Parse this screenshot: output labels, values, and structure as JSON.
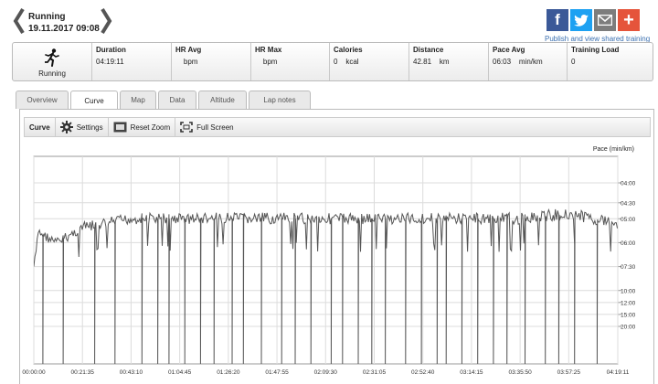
{
  "header": {
    "activity": "Running",
    "datetime": "19.11.2017 09:08",
    "prev_icon": "chevron-left-icon",
    "next_icon": "chevron-right-icon"
  },
  "share": {
    "buttons": [
      {
        "name": "facebook",
        "icon": "facebook-icon",
        "glyph": "f",
        "color": "#3b5998"
      },
      {
        "name": "twitter",
        "icon": "twitter-icon",
        "glyph": "t",
        "color": "#1da1f2"
      },
      {
        "name": "email",
        "icon": "mail-icon",
        "glyph": "✉",
        "color": "#7d7d7d"
      },
      {
        "name": "more",
        "icon": "plus-icon",
        "glyph": "+",
        "color": "#e5543b"
      }
    ],
    "link_text": "Publish and view shared training"
  },
  "summary": {
    "type_label": "Running",
    "type_icon": "runner-icon",
    "fields": [
      {
        "label": "Duration",
        "value": "04:19:11"
      },
      {
        "label": "HR Avg",
        "value": "    bpm"
      },
      {
        "label": "HR Max",
        "value": "    bpm"
      },
      {
        "label": "Calories",
        "value": "0    kcal"
      },
      {
        "label": "Distance",
        "value": "42.81    km"
      },
      {
        "label": "Pace Avg",
        "value": "06:03    min/km"
      },
      {
        "label": "Training Load",
        "value": "0"
      }
    ]
  },
  "tabs": [
    {
      "label": "Overview",
      "active": false
    },
    {
      "label": "Curve",
      "active": true
    },
    {
      "label": "Map",
      "active": false
    },
    {
      "label": "Data",
      "active": false
    },
    {
      "label": "Altitude",
      "active": false
    },
    {
      "label": "Lap notes",
      "active": false
    }
  ],
  "toolbar": {
    "curve_label": "Curve",
    "settings_label": "Settings",
    "settings_icon": "gear-icon",
    "reset_zoom_label": "Reset Zoom",
    "reset_zoom_icon": "zoom-reset-icon",
    "full_screen_label": "Full Screen",
    "full_screen_icon": "fullscreen-icon"
  },
  "chart_data": {
    "type": "line",
    "ylabel": "Pace (min/km)",
    "x_unit": "elapsed time (hh:mm:ss)",
    "x_range": [
      "00:00:00",
      "04:19:11"
    ],
    "x_ticks": [
      "00:00:00",
      "00:21:35",
      "00:43:10",
      "01:04:45",
      "01:26:20",
      "01:47:55",
      "02:09:30",
      "02:31:05",
      "02:52:40",
      "03:14:15",
      "03:35:50",
      "03:57:25",
      "04:19:11"
    ],
    "y_scale": "reciprocal (speed-linear), slower pace lower",
    "y_ticks": [
      "04:00",
      "04:30",
      "05:00",
      "06:00",
      "07:30",
      "10:00",
      "12:00",
      "15:00",
      "20:00"
    ],
    "grid": true,
    "series": [
      {
        "color": "#555555",
        "baseline_points": [
          {
            "x": "00:00:00",
            "pace": "07:30"
          },
          {
            "x": "00:02:00",
            "pace": "05:30"
          },
          {
            "x": "00:10:00",
            "pace": "06:00"
          },
          {
            "x": "00:21:35",
            "pace": "05:20"
          },
          {
            "x": "00:43:10",
            "pace": "05:00"
          },
          {
            "x": "01:04:45",
            "pace": "05:00"
          },
          {
            "x": "01:26:20",
            "pace": "05:00"
          },
          {
            "x": "01:47:55",
            "pace": "05:00"
          },
          {
            "x": "02:09:30",
            "pace": "05:00"
          },
          {
            "x": "02:31:05",
            "pace": "05:00"
          },
          {
            "x": "02:52:40",
            "pace": "05:00"
          },
          {
            "x": "03:14:15",
            "pace": "05:00"
          },
          {
            "x": "03:35:50",
            "pace": "05:00"
          },
          {
            "x": "03:57:25",
            "pace": "04:50"
          },
          {
            "x": "04:19:11",
            "pace": "05:10"
          }
        ],
        "pace_drops_to_off_scale_at": [
          "00:04:00",
          "00:13:00",
          "00:27:00",
          "00:36:00",
          "00:48:00",
          "00:55:00",
          "01:00:00",
          "01:07:00",
          "01:14:00",
          "01:20:00",
          "01:28:00",
          "01:33:00",
          "01:41:00",
          "01:50:00",
          "01:56:00",
          "02:03:00",
          "02:12:00",
          "02:17:00",
          "02:24:00",
          "02:30:00",
          "02:36:00",
          "02:45:00",
          "02:52:00",
          "02:59:00",
          "03:03:00",
          "03:10:00",
          "03:17:00",
          "03:24:00",
          "03:30:00",
          "03:38:00",
          "03:47:00",
          "03:53:00",
          "04:00:00",
          "04:10:00"
        ]
      }
    ]
  }
}
